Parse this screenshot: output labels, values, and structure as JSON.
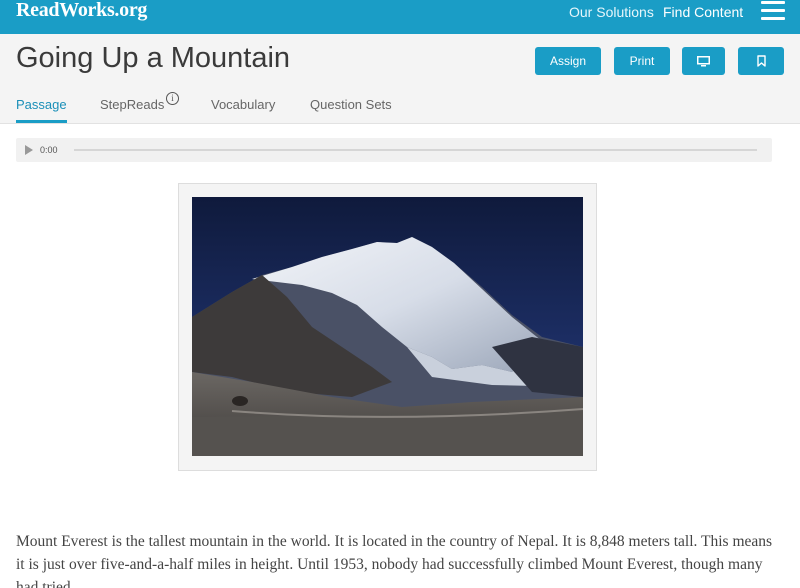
{
  "topbar": {
    "logo": "ReadWorks.org",
    "nav": [
      "Our Solutions",
      "Find Content"
    ]
  },
  "header": {
    "title": "Going Up a Mountain",
    "buttons": {
      "assign": "Assign",
      "print": "Print"
    },
    "tabs": [
      "Passage",
      "StepReads",
      "Vocabulary",
      "Question Sets"
    ],
    "info_glyph": "i"
  },
  "audio": {
    "time": "0:00"
  },
  "passage": {
    "paragraph": "Mount Everest is the tallest mountain in the world. It is located in the country of Nepal. It is 8,848 meters tall. This means it is just over five-and-a-half miles in height. Until 1953, nobody had successfully climbed Mount Everest, though many had tried."
  },
  "colors": {
    "brand": "#1a9dc6",
    "header_bg": "#f4f4f4",
    "active_tab": "#1a8fb8"
  },
  "icons": [
    "menu-icon",
    "info-icon",
    "play-icon",
    "monitor-icon",
    "bookmark-icon"
  ]
}
